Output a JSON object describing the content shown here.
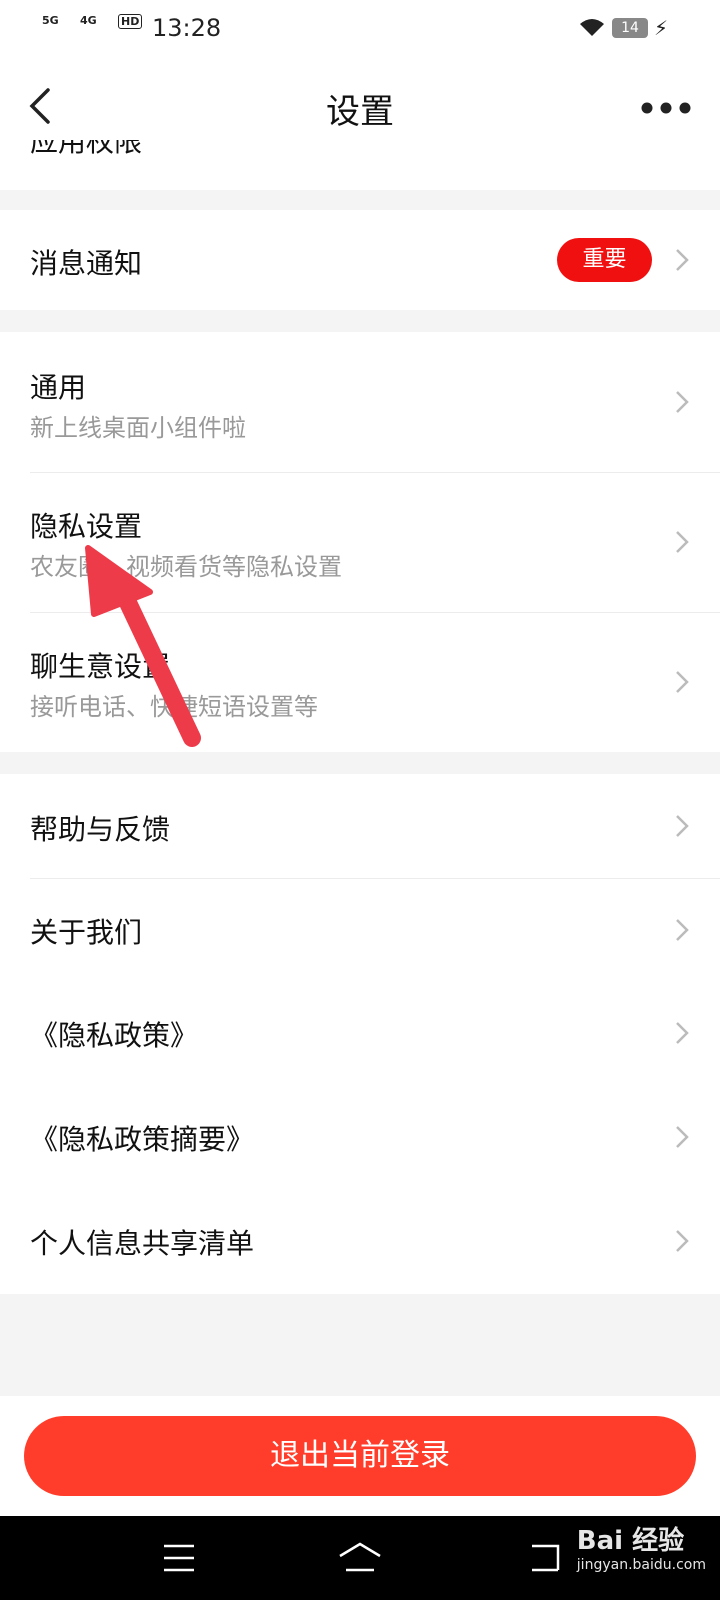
{
  "status": {
    "time": "13:28",
    "net1": "5G",
    "net2": "4G",
    "hd": "HD",
    "battery": "14"
  },
  "nav": {
    "title": "设置"
  },
  "cut_off_item": "应用权限",
  "notifications": {
    "label": "消息通知",
    "badge": "重要"
  },
  "group2": [
    {
      "label": "通用",
      "sub": "新上线桌面小组件啦"
    },
    {
      "label": "隐私设置",
      "sub": "农友圈、视频看货等隐私设置"
    },
    {
      "label": "聊生意设置",
      "sub": "接听电话、快捷短语设置等"
    }
  ],
  "group3": [
    {
      "label": "帮助与反馈"
    },
    {
      "label": "关于我们"
    },
    {
      "label": "《隐私政策》"
    },
    {
      "label": "《隐私政策摘要》"
    },
    {
      "label": "个人信息共享清单"
    }
  ],
  "logout": "退出当前登录",
  "watermark": {
    "brand": "Bai 经验",
    "url": "jingyan.baidu.com"
  },
  "colors": {
    "accent": "#ff3d2a",
    "badge": "#f01010"
  }
}
